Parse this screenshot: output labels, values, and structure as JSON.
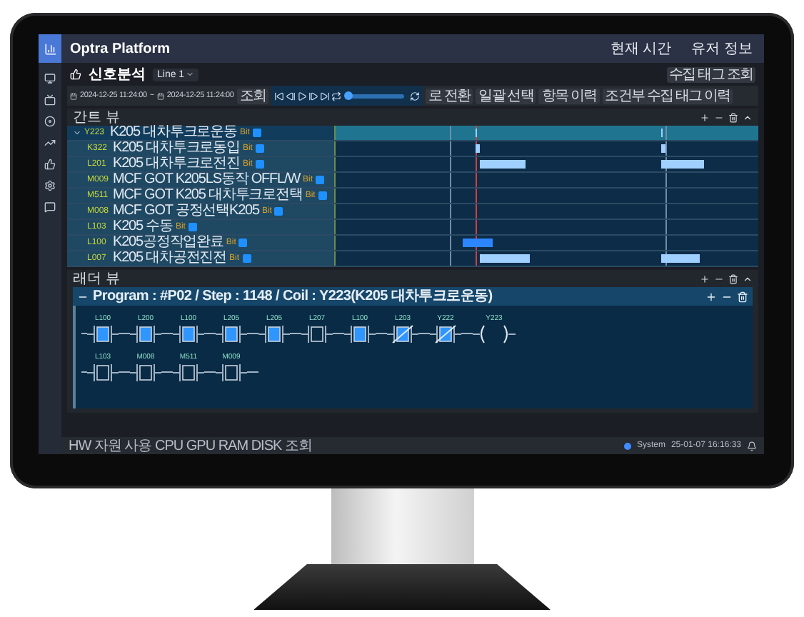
{
  "app": {
    "title": "Optra Platform",
    "header_links": [
      "현재 시간",
      "유저 정보"
    ]
  },
  "page": {
    "title": "신호분석",
    "line_select": "Line 1",
    "collect_button": "수집 태그 조회"
  },
  "toolbar": {
    "start": "2024-12-25 11:24:00",
    "separator": "~",
    "end": "2024-12-25 11:24:00",
    "search_button": "조회",
    "playback": {
      "level": 0.02
    },
    "buttons": [
      "로 전환",
      "일괄 선택",
      "항목 이력",
      "조건부 수집 태그 이력"
    ]
  },
  "gantt": {
    "title": "간트 뷰",
    "rows": [
      {
        "tag": "Y223",
        "label": "K205 대차투크로운동",
        "type": "Bit",
        "expanded": true,
        "children": [
          {
            "tag": "K322",
            "label": "K205 대차투크로동입",
            "type": "Bit"
          },
          {
            "tag": "L201",
            "label": "K205 대차투크로전진",
            "type": "Bit"
          },
          {
            "tag": "M009",
            "label": "MCF GOT K205LS동작 OFFL/W",
            "type": "Bit"
          },
          {
            "tag": "M511",
            "label": "MCF GOT K205 대차투크로전택",
            "type": "Bit"
          },
          {
            "tag": "M008",
            "label": "MCF GOT 공정선택K205",
            "type": "Bit"
          },
          {
            "tag": "L103",
            "label": "K205 수동",
            "type": "Bit"
          },
          {
            "tag": "L100",
            "label": "K205공정작업완료",
            "type": "Bit"
          },
          {
            "tag": "L007",
            "label": "K205 대차공전진전",
            "type": "Bit"
          }
        ]
      }
    ]
  },
  "ladder": {
    "title": "래더 뷰",
    "program": "Program : #P02 / Step : 1148 / Coil : Y223(K205 대차투크로운동)",
    "rungs": [
      {
        "contacts": [
          {
            "tag": "L100",
            "kind": "no",
            "on": true
          },
          {
            "tag": "L200",
            "kind": "no",
            "on": true
          },
          {
            "tag": "L100",
            "kind": "no",
            "on": true
          },
          {
            "tag": "L205",
            "kind": "no",
            "on": true
          },
          {
            "tag": "L205",
            "kind": "no",
            "on": true
          },
          {
            "tag": "L207",
            "kind": "no",
            "on": false
          },
          {
            "tag": "L100",
            "kind": "no",
            "on": true
          },
          {
            "tag": "L203",
            "kind": "nc",
            "on": true
          },
          {
            "tag": "Y222",
            "kind": "nc",
            "on": true
          }
        ],
        "coil": {
          "tag": "Y223"
        }
      },
      {
        "contacts": [
          {
            "tag": "L103",
            "kind": "no",
            "on": false
          },
          {
            "tag": "M008",
            "kind": "no",
            "on": false
          },
          {
            "tag": "M511",
            "kind": "no",
            "on": false
          },
          {
            "tag": "M009",
            "kind": "no",
            "on": false
          }
        ]
      }
    ]
  },
  "status_bar": {
    "resources": "HW 자원 사용 CPU GPU RAM DISK 조회",
    "system": "System",
    "time": "25-01-07 16:16:33"
  }
}
